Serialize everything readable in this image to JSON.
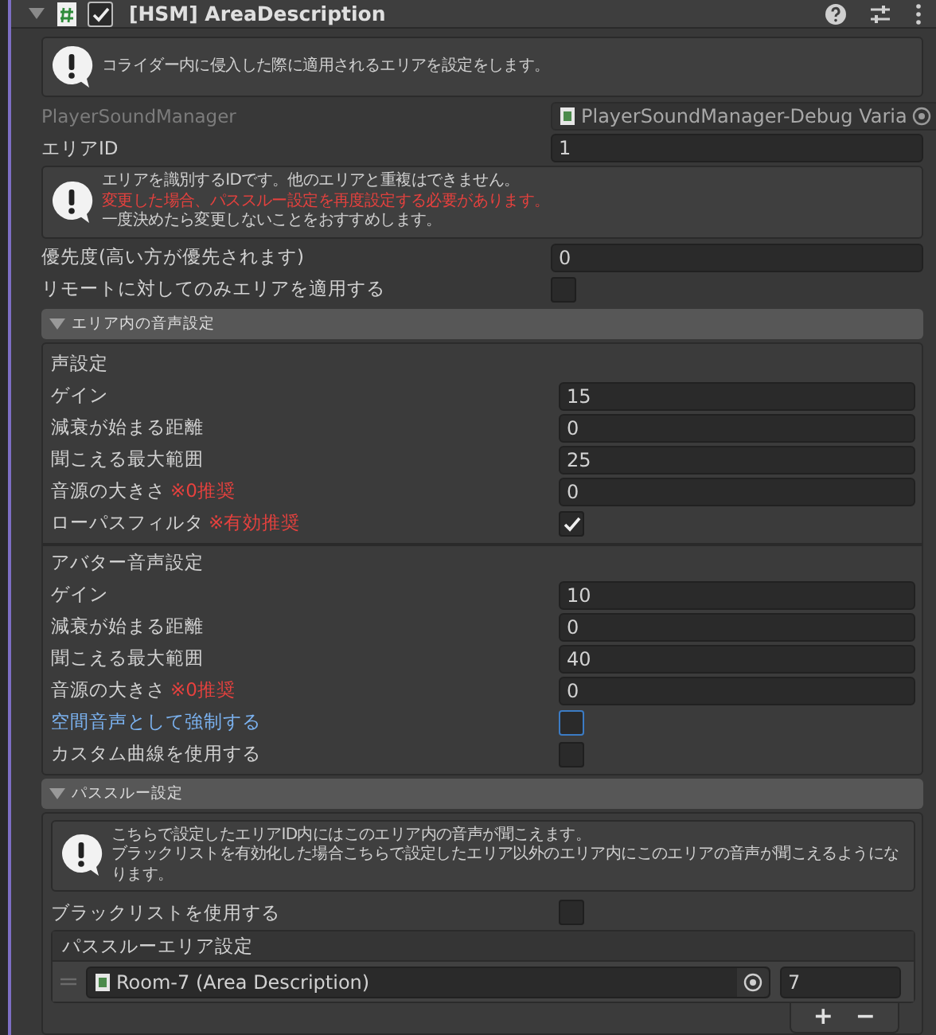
{
  "header": {
    "title": "[HSM] AreaDescription",
    "enabled": true,
    "expanded": true
  },
  "intro": {
    "lines": [
      {
        "text": "コライダー内に侵入した際に適用されるエリアを設定をします。",
        "kind": "normal"
      }
    ]
  },
  "script_ref": {
    "label": "PlayerSoundManager",
    "value": "PlayerSoundManager-Debug Varia",
    "disabled": true
  },
  "area_id": {
    "label": "エリアID",
    "value": "1"
  },
  "area_id_help": {
    "lines": [
      {
        "text": "エリアを識別するIDです。他のエリアと重複はできません。",
        "kind": "normal"
      },
      {
        "text": "変更した場合、パススルー設定を再度設定する必要があります。",
        "kind": "alert"
      },
      {
        "text": "一度決めたら変更しないことをおすすめします。",
        "kind": "normal"
      }
    ]
  },
  "priority": {
    "label": "優先度(高い方が優先されます)",
    "value": "0"
  },
  "remote_only": {
    "label": "リモートに対してのみエリアを適用する",
    "checked": false
  },
  "voice_section": {
    "title": "エリア内の音声設定",
    "expanded": true,
    "groups": [
      {
        "title": "声設定",
        "rows": [
          {
            "kind": "number",
            "label": "ゲイン",
            "value": "15"
          },
          {
            "kind": "number",
            "label": "減衰が始まる距離",
            "value": "0"
          },
          {
            "kind": "number",
            "label": "聞こえる最大範囲",
            "value": "25"
          },
          {
            "kind": "number",
            "label": "音源の大きさ",
            "note": "※0推奨",
            "value": "0"
          },
          {
            "kind": "toggle",
            "label": "ローパスフィルタ",
            "note": "※有効推奨",
            "checked": true,
            "focused": false
          }
        ]
      },
      {
        "title": "アバター音声設定",
        "rows": [
          {
            "kind": "number",
            "label": "ゲイン",
            "value": "10"
          },
          {
            "kind": "number",
            "label": "減衰が始まる距離",
            "value": "0"
          },
          {
            "kind": "number",
            "label": "聞こえる最大範囲",
            "value": "40"
          },
          {
            "kind": "number",
            "label": "音源の大きさ",
            "note": "※0推奨",
            "value": "0"
          },
          {
            "kind": "toggle",
            "label": "空間音声として強制する",
            "checked": false,
            "focused": true
          },
          {
            "kind": "toggle",
            "label": "カスタム曲線を使用する",
            "checked": false,
            "focused": false
          }
        ]
      }
    ]
  },
  "passthrough_section": {
    "title": "パススルー設定",
    "expanded": true,
    "help": {
      "lines": [
        {
          "text": "こちらで設定したエリアID内にはこのエリア内の音声が聞こえます。",
          "kind": "normal"
        },
        {
          "text": "ブラックリストを有効化した場合こちらで設定したエリア以外のエリア内にこのエリアの音声が聞こえるようになります。",
          "kind": "normal"
        }
      ]
    },
    "blacklist": {
      "label": "ブラックリストを使用する",
      "checked": false
    },
    "list": {
      "title": "パススルーエリア設定",
      "items": [
        {
          "area": "Room-7 (Area Description)",
          "id": "7"
        }
      ],
      "buttons": [
        "+",
        "−"
      ]
    }
  }
}
